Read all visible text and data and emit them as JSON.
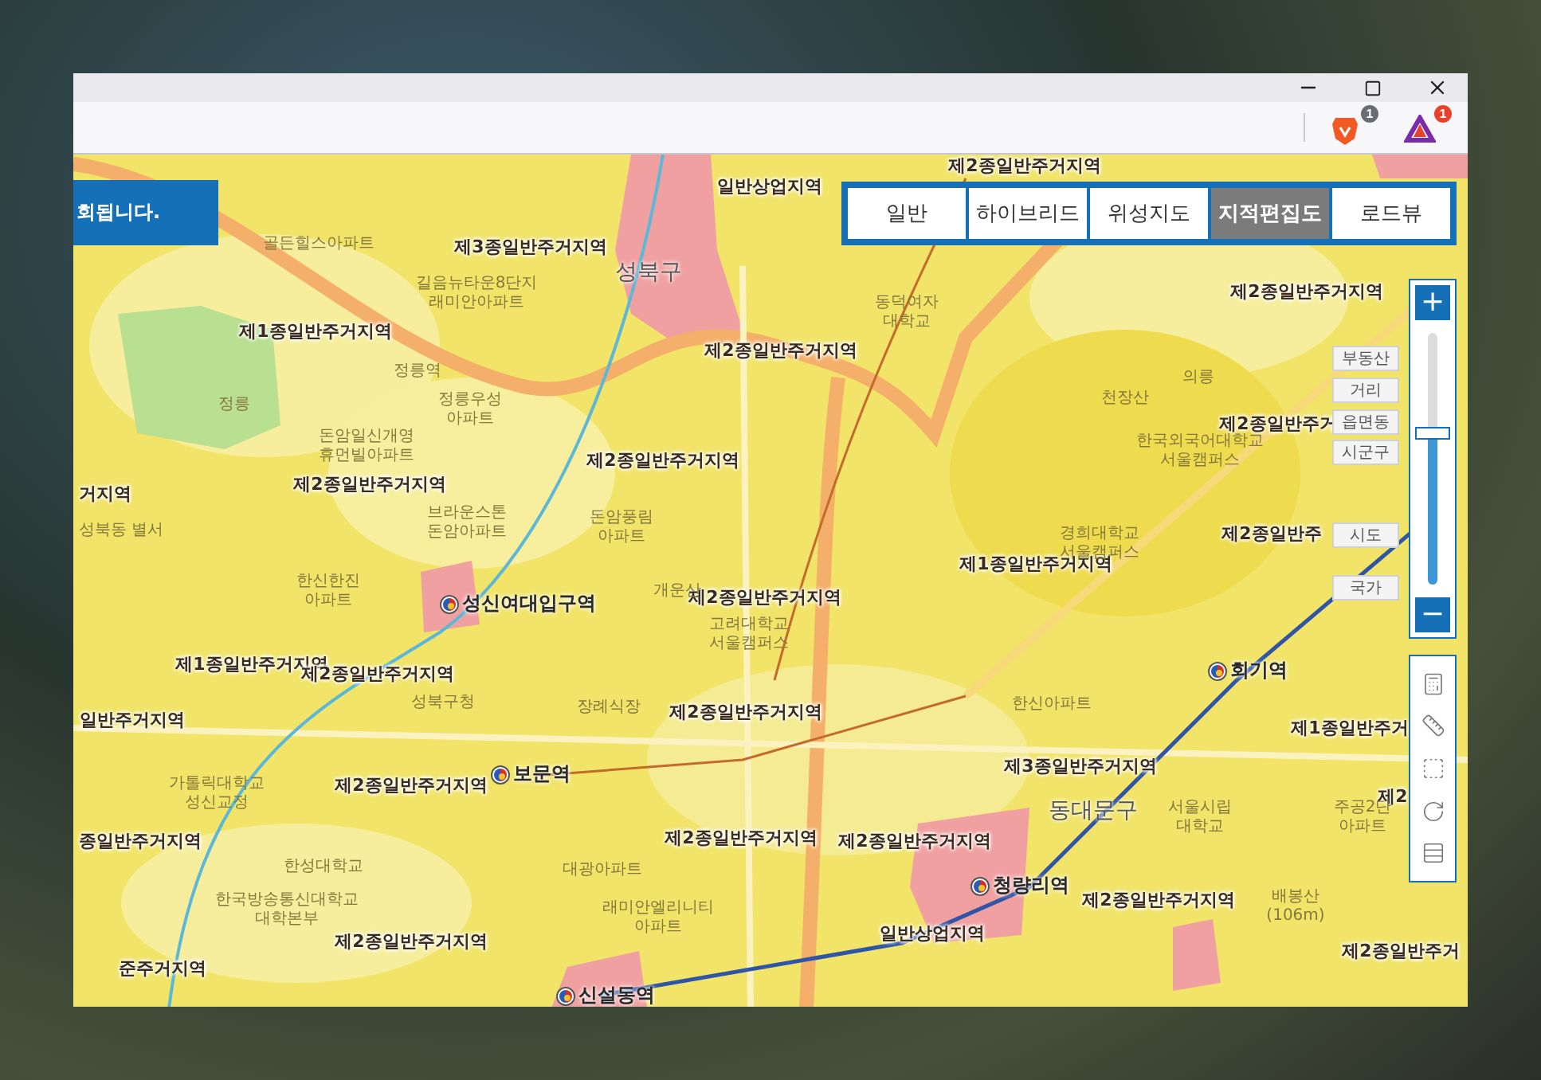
{
  "browser": {
    "extensions": [
      {
        "kind": "shield",
        "badge": "1"
      },
      {
        "kind": "triangle",
        "badge": "1"
      }
    ]
  },
  "map": {
    "notice": "회됩니다.",
    "map_types": [
      {
        "label": "일반",
        "selected": false
      },
      {
        "label": "하이브리드",
        "selected": false
      },
      {
        "label": "위성지도",
        "selected": false
      },
      {
        "label": "지적편집도",
        "selected": true
      },
      {
        "label": "로드뷰",
        "selected": false
      }
    ],
    "zoom": {
      "in": "+",
      "out": "−",
      "level": 0.6,
      "marks": [
        "부동산",
        "거리",
        "읍면동",
        "시군구",
        "시도",
        "국가"
      ]
    },
    "labels": [
      {
        "kind": "zone",
        "lines": [
          "제2종일반주거지역"
        ]
      },
      {
        "kind": "zone",
        "lines": [
          "일반상업지역"
        ]
      },
      {
        "kind": "zone",
        "lines": [
          "제3종일반주거지역"
        ]
      },
      {
        "kind": "district",
        "lines": [
          "성북구"
        ]
      },
      {
        "kind": "zone",
        "lines": [
          "제2종일반주거지역"
        ]
      },
      {
        "kind": "zone",
        "lines": [
          "제1종일반주거지역"
        ]
      },
      {
        "kind": "zone",
        "lines": [
          "제2종일반주거지역"
        ]
      },
      {
        "kind": "zone",
        "lines": [
          "제2종일반주거"
        ]
      },
      {
        "kind": "zone",
        "lines": [
          "제2종일반주거지역"
        ]
      },
      {
        "kind": "zone",
        "lines": [
          "제2종일반주거지역"
        ]
      },
      {
        "kind": "zone",
        "lines": [
          "거지역"
        ]
      },
      {
        "kind": "zone",
        "lines": [
          "제2종일반주"
        ]
      },
      {
        "kind": "zone",
        "lines": [
          "제1종일반주거지역"
        ]
      },
      {
        "kind": "station",
        "lines": [
          "성신여대입구역"
        ]
      },
      {
        "kind": "zone",
        "lines": [
          "제2종일반주거지역"
        ]
      },
      {
        "kind": "zone",
        "lines": [
          "제1종일반주거지역"
        ]
      },
      {
        "kind": "zone",
        "lines": [
          "제2종일반주거지역"
        ]
      },
      {
        "kind": "station",
        "lines": [
          "회기역"
        ]
      },
      {
        "kind": "zone",
        "lines": [
          "일반주거지역"
        ]
      },
      {
        "kind": "zone",
        "lines": [
          "제2종일반주거지역"
        ]
      },
      {
        "kind": "zone",
        "lines": [
          "제1종일반주거"
        ]
      },
      {
        "kind": "station",
        "lines": [
          "보문역"
        ]
      },
      {
        "kind": "zone",
        "lines": [
          "제3종일반주거지역"
        ]
      },
      {
        "kind": "zone",
        "lines": [
          "제2종일반주거지역"
        ]
      },
      {
        "kind": "district",
        "lines": [
          "동대문구"
        ]
      },
      {
        "kind": "zone",
        "lines": [
          "종일반주거지역"
        ]
      },
      {
        "kind": "zone",
        "lines": [
          "제2종일반주거지역"
        ]
      },
      {
        "kind": "zone",
        "lines": [
          "제2종일반주거지역"
        ]
      },
      {
        "kind": "zone",
        "lines": [
          "제2"
        ]
      },
      {
        "kind": "station",
        "lines": [
          "청량리역"
        ]
      },
      {
        "kind": "zone",
        "lines": [
          "제2종일반주거지역"
        ]
      },
      {
        "kind": "zone",
        "lines": [
          "제2종일반주거지역"
        ]
      },
      {
        "kind": "zone",
        "lines": [
          "일반상업지역"
        ]
      },
      {
        "kind": "zone",
        "lines": [
          "제2종일반주거"
        ]
      },
      {
        "kind": "zone",
        "lines": [
          "준주거지역"
        ]
      },
      {
        "kind": "station",
        "lines": [
          "신설동역"
        ]
      },
      {
        "kind": "place",
        "lines": [
          "골든힐스아파트"
        ]
      },
      {
        "kind": "place",
        "lines": [
          "길음뉴타운8단지",
          "래미안아파트"
        ]
      },
      {
        "kind": "place",
        "lines": [
          "정릉"
        ]
      },
      {
        "kind": "place",
        "lines": [
          "정릉역"
        ]
      },
      {
        "kind": "place",
        "lines": [
          "정릉우성",
          "아파트"
        ]
      },
      {
        "kind": "place",
        "lines": [
          "돈암일신개영",
          "휴먼빌아파트"
        ]
      },
      {
        "kind": "place",
        "lines": [
          "브라운스톤",
          "돈암아파트"
        ]
      },
      {
        "kind": "place",
        "lines": [
          "돈암풍림",
          "아파트"
        ]
      },
      {
        "kind": "place",
        "lines": [
          "한신한진",
          "아파트"
        ]
      },
      {
        "kind": "place",
        "lines": [
          "성북동 별서"
        ]
      },
      {
        "kind": "place",
        "lines": [
          "개운산"
        ]
      },
      {
        "kind": "place",
        "lines": [
          "고려대학교",
          "서울캠퍼스"
        ]
      },
      {
        "kind": "place",
        "lines": [
          "동덕여자",
          "대학교"
        ]
      },
      {
        "kind": "place",
        "lines": [
          "천장산"
        ]
      },
      {
        "kind": "place",
        "lines": [
          "의릉"
        ]
      },
      {
        "kind": "place",
        "lines": [
          "한국외국어대학교",
          "서울캠퍼스"
        ]
      },
      {
        "kind": "place",
        "lines": [
          "경희대학교",
          "서울캠퍼스"
        ]
      },
      {
        "kind": "place",
        "lines": [
          "성북구청"
        ]
      },
      {
        "kind": "place",
        "lines": [
          "장례식장"
        ]
      },
      {
        "kind": "place",
        "lines": [
          "가톨릭대학교",
          "성신교정"
        ]
      },
      {
        "kind": "place",
        "lines": [
          "한성대학교"
        ]
      },
      {
        "kind": "place",
        "lines": [
          "한국방송통신대학교",
          "대학본부"
        ]
      },
      {
        "kind": "place",
        "lines": [
          "대광아파트"
        ]
      },
      {
        "kind": "place",
        "lines": [
          "래미안엘리니티",
          "아파트"
        ]
      },
      {
        "kind": "place",
        "lines": [
          "서울시립",
          "대학교"
        ]
      },
      {
        "kind": "place",
        "lines": [
          "주공2단",
          "아파트"
        ]
      },
      {
        "kind": "place",
        "lines": [
          "배봉산",
          "(106m)"
        ]
      },
      {
        "kind": "place",
        "lines": [
          "한신아파트"
        ]
      }
    ]
  }
}
